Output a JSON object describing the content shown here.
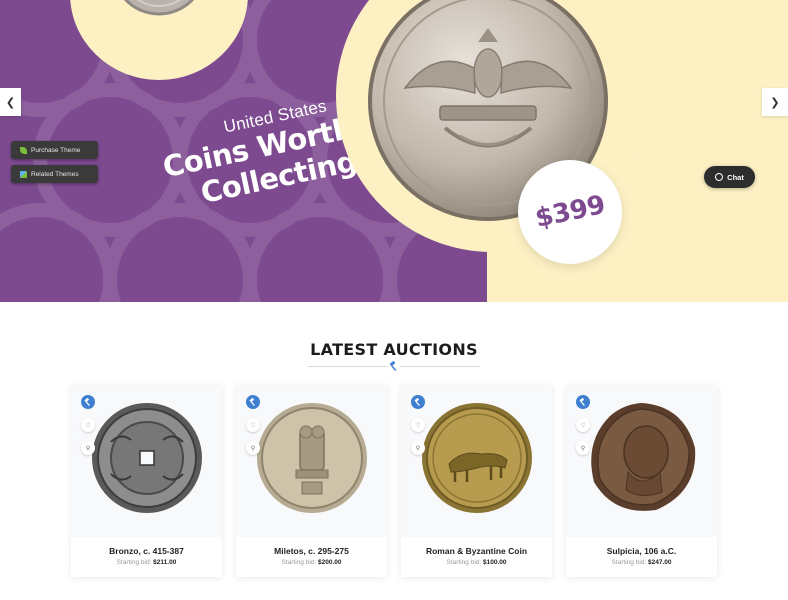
{
  "hero": {
    "subtitle": "United States",
    "title_line1": "Coins Worth",
    "title_line2": "Collecting",
    "price": "$399",
    "accent_color": "#7d4a90",
    "cream_color": "#fdf1c4"
  },
  "slider": {
    "prev_icon": "chevron-left-icon",
    "next_icon": "chevron-right-icon"
  },
  "side_buttons": {
    "purchase": "Purchase Theme",
    "related": "Related Themes"
  },
  "chat": {
    "label": "Chat"
  },
  "section": {
    "title": "LATEST AUCTIONS"
  },
  "products": [
    {
      "name": "Bronzo, c. 415-387",
      "bid_label": "Starting bid:",
      "bid": "$211.00"
    },
    {
      "name": "Miletos, c. 295-275",
      "bid_label": "Starting bid:",
      "bid": "$200.00"
    },
    {
      "name": "Roman & Byzantine Coin",
      "bid_label": "Starting bid:",
      "bid": "$100.00"
    },
    {
      "name": "Sulpicia, 106 a.C.",
      "bid_label": "Starting bid:",
      "bid": "$247.00"
    }
  ]
}
